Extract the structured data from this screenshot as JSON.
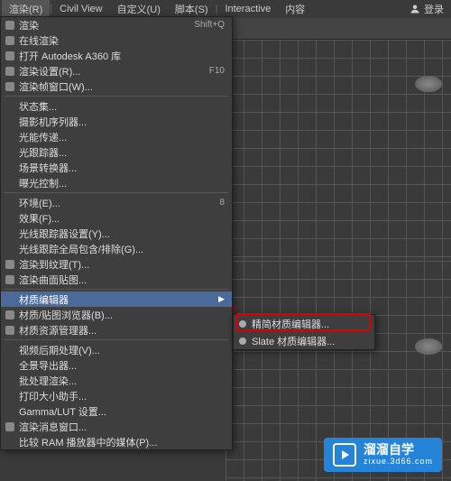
{
  "menubar": {
    "items": [
      {
        "label": "渲染(R)",
        "accel": "R"
      },
      {
        "label": "Civil View"
      },
      {
        "label": "自定义(U)",
        "accel": "U"
      },
      {
        "label": "脚本(S)",
        "accel": "S"
      },
      {
        "label": "Interactive"
      },
      {
        "label": "内容"
      }
    ],
    "login": "登录"
  },
  "menu": {
    "items": [
      {
        "label": "渲染",
        "shortcut": "Shift+Q",
        "icon": "teapot"
      },
      {
        "label": "在线渲染",
        "icon": "teapot"
      },
      {
        "label": "打开 Autodesk A360 库",
        "icon": "cloud"
      },
      {
        "label": "渲染设置(R)...",
        "shortcut": "F10",
        "icon": "gear"
      },
      {
        "label": "渲染帧窗口(W)...",
        "icon": "window"
      },
      {
        "sep": true
      },
      {
        "label": "状态集..."
      },
      {
        "label": "摄影机序列器..."
      },
      {
        "label": "光能传递..."
      },
      {
        "label": "光跟踪器..."
      },
      {
        "label": "场景转换器..."
      },
      {
        "label": "曝光控制..."
      },
      {
        "sep": true
      },
      {
        "label": "环境(E)...",
        "shortcut": "8"
      },
      {
        "label": "效果(F)..."
      },
      {
        "label": "光线跟踪器设置(Y)..."
      },
      {
        "label": "光线跟踪全局包含/排除(G)..."
      },
      {
        "label": "渲染到纹理(T)...",
        "icon": "texture"
      },
      {
        "label": "渲染曲面贴图...",
        "icon": "surface"
      },
      {
        "sep": true
      },
      {
        "label": "材质编辑器",
        "arrow": true,
        "highlighted": true
      },
      {
        "label": "材质/贴图浏览器(B)...",
        "icon": "browser"
      },
      {
        "label": "材质资源管理器...",
        "icon": "explorer"
      },
      {
        "sep": true
      },
      {
        "label": "视频后期处理(V)..."
      },
      {
        "label": "全景导出器..."
      },
      {
        "label": "批处理渲染..."
      },
      {
        "label": "打印大小助手..."
      },
      {
        "label": "Gamma/LUT 设置..."
      },
      {
        "label": "渲染消息窗口...",
        "icon": "window"
      },
      {
        "label": "比较 RAM 播放器中的媒体(P)..."
      }
    ]
  },
  "submenu": {
    "items": [
      {
        "label": "精简材质编辑器...",
        "icon": "compact",
        "boxed": true
      },
      {
        "label": "Slate 材质编辑器...",
        "icon": "slate"
      }
    ]
  },
  "watermark": {
    "main": "溜溜自学",
    "sub": "zixue.3d66.com"
  }
}
